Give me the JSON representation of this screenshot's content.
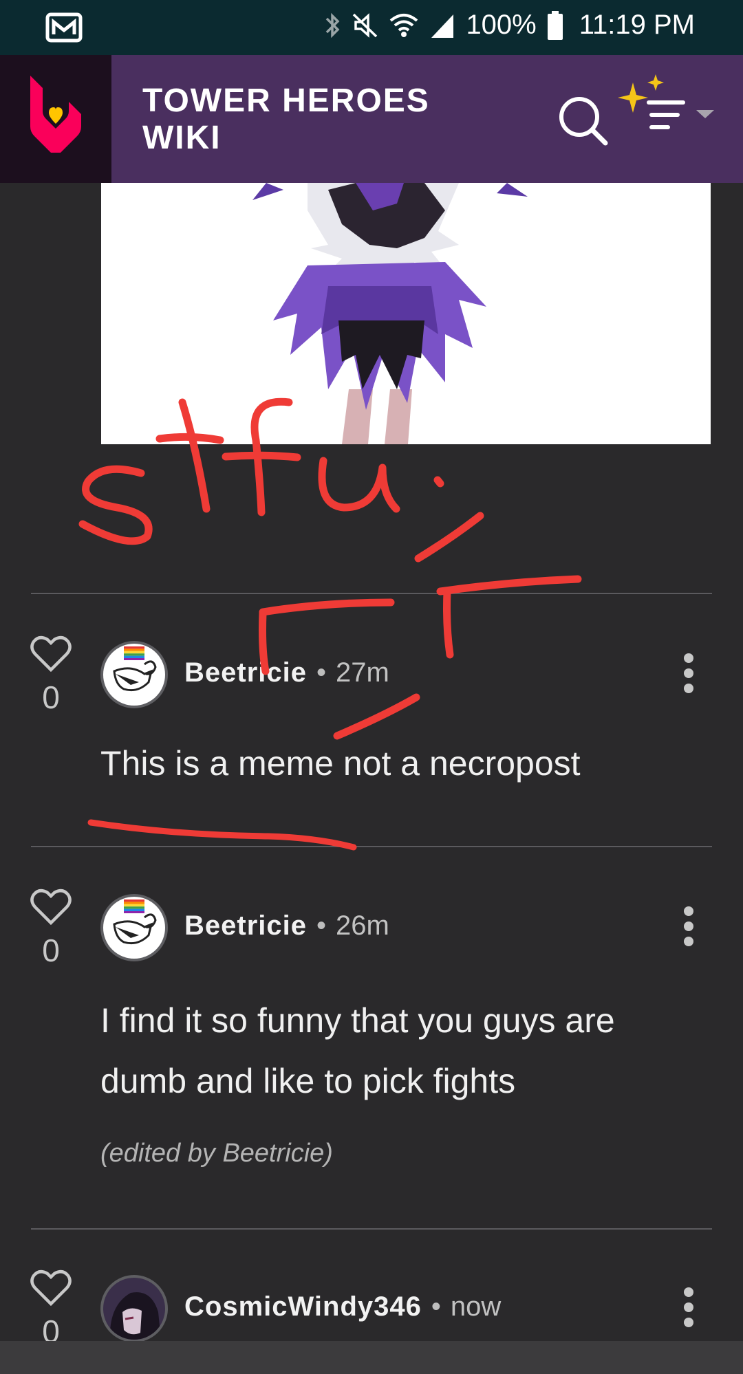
{
  "statusbar": {
    "battery": "100%",
    "time": "11:19 PM"
  },
  "wiki": {
    "title_line1": "TOWER HEROES",
    "title_line2": "WIKI"
  },
  "comments": [
    {
      "likes": "0",
      "author": "Beetricie",
      "time": "27m",
      "text": "This is a meme not a necropost"
    },
    {
      "likes": "0",
      "author": "Beetricie",
      "time": "26m",
      "text_line1": "I find it so funny that you guys are",
      "text_line2": "dumb and like to pick fights",
      "edited": "(edited by Beetricie)"
    },
    {
      "likes": "0",
      "author": "CosmicWindy346",
      "time": "now"
    }
  ],
  "annotation": {
    "handwriting": "stfu."
  },
  "colors": {
    "status_bg": "#0b2a30",
    "wiki_bar": "#4a2f5f",
    "page_bg": "#2a292b",
    "scribble": "#ef3b36",
    "sparkle": "#f5c518",
    "fandom_logo": "#fa005a"
  }
}
